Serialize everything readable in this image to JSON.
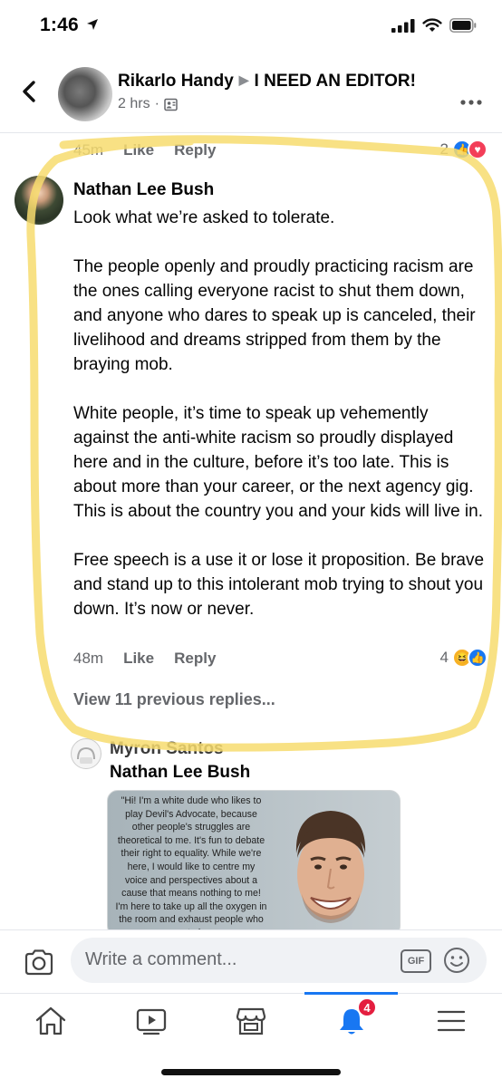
{
  "status_bar": {
    "time": "1:46"
  },
  "header": {
    "author": "Rikarlo Handy",
    "group": "I NEED AN EDITOR!",
    "timestamp": "2 hrs",
    "separator": "·"
  },
  "prev_comment": {
    "time": "45m",
    "like": "Like",
    "reply": "Reply",
    "reaction_count": "2",
    "reactions": [
      "like-icon",
      "love-icon"
    ]
  },
  "comment": {
    "author": "Nathan Lee Bush",
    "paragraphs": [
      "Look what we’re asked to tolerate.",
      "The people openly and proudly practicing racism are the ones calling everyone racist to shut them down, and anyone who dares to speak up is canceled, their livelihood and dreams stripped from them by the braying mob.",
      "White people, it’s time to speak up vehemently against the anti-white racism so proudly displayed here and in the culture, before it’s too late. This is about more than your career, or the next agency gig. This is about the country you and your kids will live in.",
      "Free speech is a use it or lose it proposition. Be brave and stand up to this intolerant mob trying to shout you down. It’s now or never."
    ],
    "time": "48m",
    "like": "Like",
    "reply": "Reply",
    "reaction_count": "4",
    "reactions": [
      "haha-icon",
      "like-icon"
    ],
    "view_previous": "View 11 previous replies..."
  },
  "reply": {
    "author": "Myron Santos",
    "mention": "Nathan Lee Bush",
    "image_text": "\"Hi! I'm a white dude who likes to play Devil's Advocate, because other people's struggles are theoretical to me. It's fun to debate their right to equality. While we're here, I would like to centre my voice and perspectives about a cause that means nothing to me! I'm here to take up all the oxygen in the room and exhaust people who are trying"
  },
  "composer": {
    "placeholder": "Write a comment...",
    "gif_label": "GIF"
  },
  "tabbar": {
    "tabs": [
      "home-icon",
      "video-icon",
      "marketplace-icon",
      "notifications-icon",
      "menu-icon"
    ],
    "notification_badge": "4",
    "active": "notifications"
  },
  "colors": {
    "accent": "#1877f2",
    "highlight": "#f7dc6f",
    "badge": "#e41e3f",
    "muted": "#65676b"
  }
}
